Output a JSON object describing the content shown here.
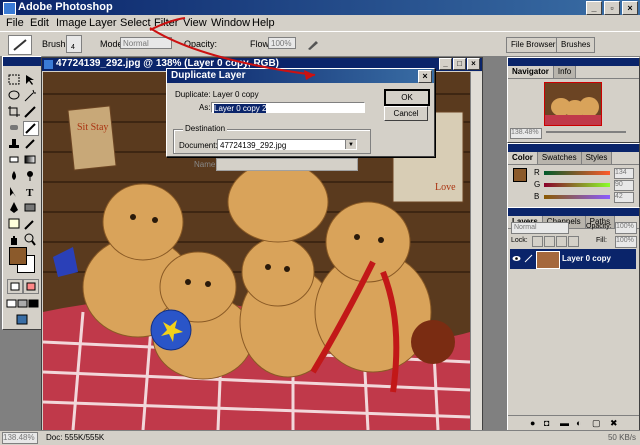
{
  "app": {
    "title": "Adobe Photoshop"
  },
  "menu": [
    "File",
    "Edit",
    "Image",
    "Layer",
    "Select",
    "Filter",
    "View",
    "Window",
    "Help"
  ],
  "options": {
    "brush_label": "Brush:",
    "brush_size": "4",
    "mode_label": "Mode:",
    "mode_value": "Normal",
    "opacity_label": "Opacity:",
    "flow_label": "Flow:",
    "flow_value": "100%",
    "palette_tabs": [
      "File Browser",
      "Brushes"
    ]
  },
  "document": {
    "title": "47724139_292.jpg @ 138% (Layer 0 copy, RGB)",
    "sign_text": "Sit Stay",
    "sign2_text": "Love"
  },
  "navigator": {
    "tabs": [
      "Navigator",
      "Info"
    ],
    "zoom": "138.48%"
  },
  "color": {
    "tabs": [
      "Color",
      "Swatches",
      "Styles"
    ],
    "channels": [
      {
        "label": "R",
        "value": "134"
      },
      {
        "label": "G",
        "value": "90"
      },
      {
        "label": "B",
        "value": "42"
      }
    ],
    "fg_color": "#8b5a2b"
  },
  "layers": {
    "tabs": [
      "Layers",
      "Channels",
      "Paths"
    ],
    "blend_mode": "Normal",
    "opacity_label": "Opacity:",
    "opacity_value": "100%",
    "lock_label": "Lock:",
    "fill_label": "Fill:",
    "fill_value": "100%",
    "layer_name": "Layer 0 copy"
  },
  "dialog": {
    "title": "Duplicate Layer",
    "duplicate_label": "Duplicate: Layer 0 copy",
    "as_label": "As:",
    "as_value": "Layer 0 copy 2",
    "ok": "OK",
    "cancel": "Cancel",
    "destination_label": "Destination",
    "document_label": "Document:",
    "document_value": "47724139_292.jpg",
    "name_label": "Name:"
  },
  "status": {
    "zoom": "138.48%",
    "doc": "Doc: 555K/555K",
    "right": "50 KB/s"
  },
  "colors": {
    "accent": "#0a246a",
    "annotation": "#cc1111"
  }
}
